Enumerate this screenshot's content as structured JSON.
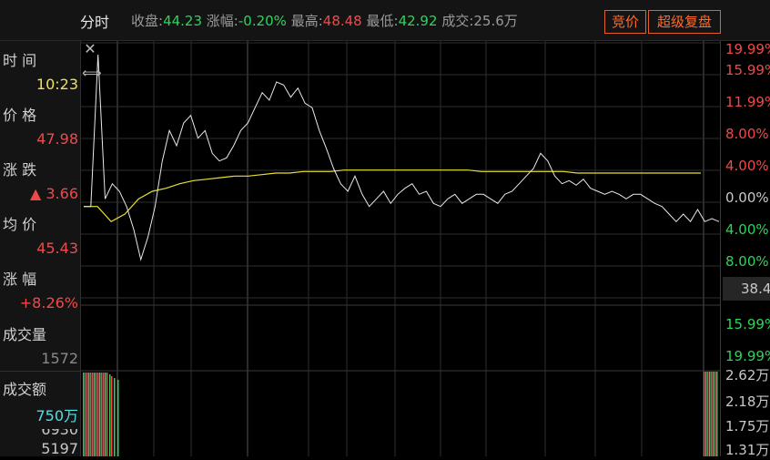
{
  "header": {
    "tab_label": "分时",
    "close_label": "收盘:",
    "close_value": "44.23",
    "change_pct_label": "涨幅:",
    "change_pct_value": "-0.20%",
    "high_label": "最高:",
    "high_value": "48.48",
    "low_label": "最低:",
    "low_value": "42.92",
    "volume_label": "成交:",
    "volume_value": "25.6万",
    "bid_button": "竞价",
    "replay_button": "超级复盘"
  },
  "info_panel": {
    "time_label": "时 间",
    "time_value": "10:23",
    "price_label": "价 格",
    "price_value": "47.98",
    "change_label": "涨 跌",
    "change_value": "▲ 3.66",
    "avg_label": "均 价",
    "avg_value": "45.43",
    "pct_label": "涨 幅",
    "pct_value": "+8.26%",
    "vol_label": "成交量",
    "vol_value": "1572",
    "amount_label": "成交额",
    "amount_value": "750万",
    "row_a_value": "6930",
    "row_b_value": "5197"
  },
  "price_axis": [
    "19.99%",
    "15.99%",
    "11.99%",
    "8.00%",
    "4.00%",
    "0.00%",
    "4.00%",
    "8.00%"
  ],
  "lower_axis": [
    "15.99%",
    "19.99%"
  ],
  "current_price_label": "38.4",
  "amount_axis": [
    "2.62万",
    "2.18万",
    "1.75万",
    "1.31万"
  ],
  "icons": {
    "close": "close-icon",
    "resize": "resize-horizontal-icon"
  },
  "colors": {
    "up": "#ef4a4a",
    "down": "#2fd35a",
    "price_line": "#e8e8e8",
    "avg_line": "#e8e030",
    "accent": "#ff6a2a"
  },
  "chart_data": {
    "type": "line",
    "series": [
      {
        "values": [
          -0.2,
          -0.2,
          10.5,
          -0.15,
          -0.05,
          -0.1,
          -0.2,
          -0.35,
          -0.55,
          -0.4,
          -0.2,
          0.1,
          0.3,
          0.2,
          0.35,
          0.4,
          0.25,
          0.3,
          0.15,
          0.1,
          0.12,
          0.2,
          0.3,
          0.35,
          0.45,
          0.55,
          0.5,
          0.62,
          0.6,
          0.52,
          0.58,
          0.48,
          0.45,
          0.3,
          0.18,
          0.05,
          -0.05,
          -0.1,
          0.0,
          -0.12,
          -0.2,
          -0.15,
          -0.1,
          -0.18,
          -0.12,
          -0.08,
          -0.05,
          -0.12,
          -0.1,
          -0.18,
          -0.2,
          -0.15,
          -0.12,
          -0.18,
          -0.15,
          -0.12,
          -0.12,
          -0.15,
          -0.18,
          -0.12,
          -0.1,
          -0.05,
          0.0,
          0.05,
          0.15,
          0.1,
          0.0,
          -0.05,
          -0.03,
          -0.06,
          -0.02,
          -0.08,
          -0.1,
          -0.12,
          -0.1,
          -0.12,
          -0.15,
          -0.12,
          -0.12,
          -0.15,
          -0.18,
          -0.2,
          -0.25,
          -0.3,
          -0.25,
          -0.3,
          -0.22,
          -0.3,
          -0.28,
          -0.3
        ]
      },
      {
        "values": [
          -0.2,
          -0.2,
          -0.3,
          -0.25,
          -0.15,
          -0.1,
          -0.08,
          -0.05,
          -0.03,
          -0.02,
          -0.01,
          0.0,
          0.0,
          0.01,
          0.02,
          0.02,
          0.03,
          0.03,
          0.03,
          0.04,
          0.04,
          0.04,
          0.04,
          0.04,
          0.04,
          0.04,
          0.04,
          0.04,
          0.04,
          0.03,
          0.03,
          0.03,
          0.03,
          0.03,
          0.03,
          0.03,
          0.02,
          0.02,
          0.02,
          0.02,
          0.02,
          0.02,
          0.02,
          0.02,
          0.02,
          0.02
        ]
      }
    ],
    "ylim": [
      -0.7,
      0.8
    ]
  }
}
